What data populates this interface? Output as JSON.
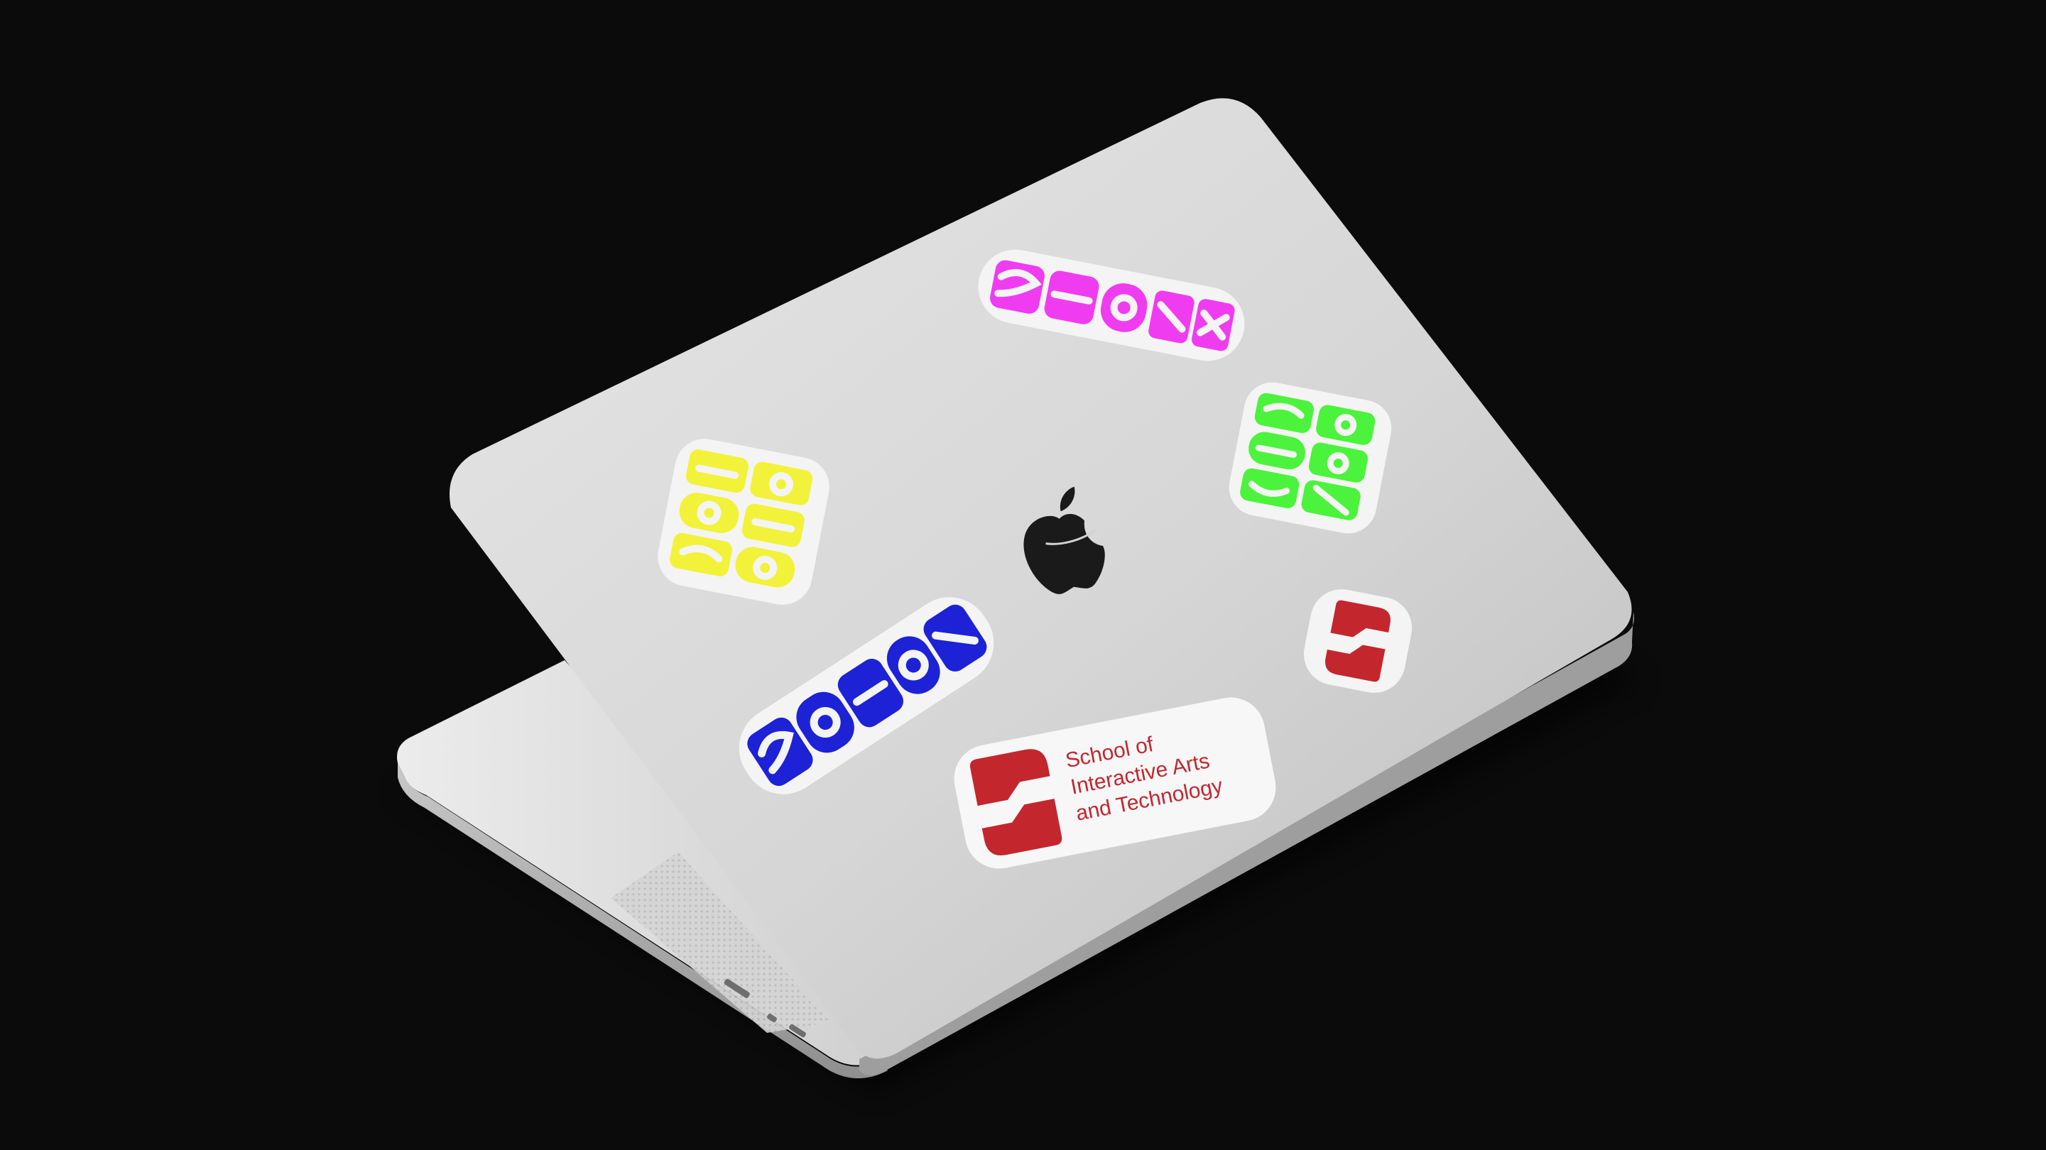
{
  "scene": {
    "background_color": "#0b0b0b",
    "device": "laptop",
    "device_color": "#d9d9d9",
    "lid_logo_icon": "apple-logo-icon"
  },
  "stickers": {
    "magenta_wordmark": {
      "icon": "siat-wordmark-icon",
      "color": "#f03cf0"
    },
    "green_wordmark": {
      "icon": "siat-wordmark-icon",
      "color": "#4cf33c"
    },
    "yellow_wordmark": {
      "icon": "siat-wordmark-icon",
      "color": "#f2f23a"
    },
    "blue_wordmark": {
      "icon": "siat-wordmark-icon",
      "color": "#1d22d6"
    },
    "red_mark": {
      "icon": "siat-s-mark-icon",
      "color": "#c4262e"
    },
    "school_label": {
      "icon": "siat-s-mark-icon",
      "color": "#c4262e",
      "lines": [
        "School of",
        "Interactive Arts",
        "and Technology"
      ]
    }
  }
}
